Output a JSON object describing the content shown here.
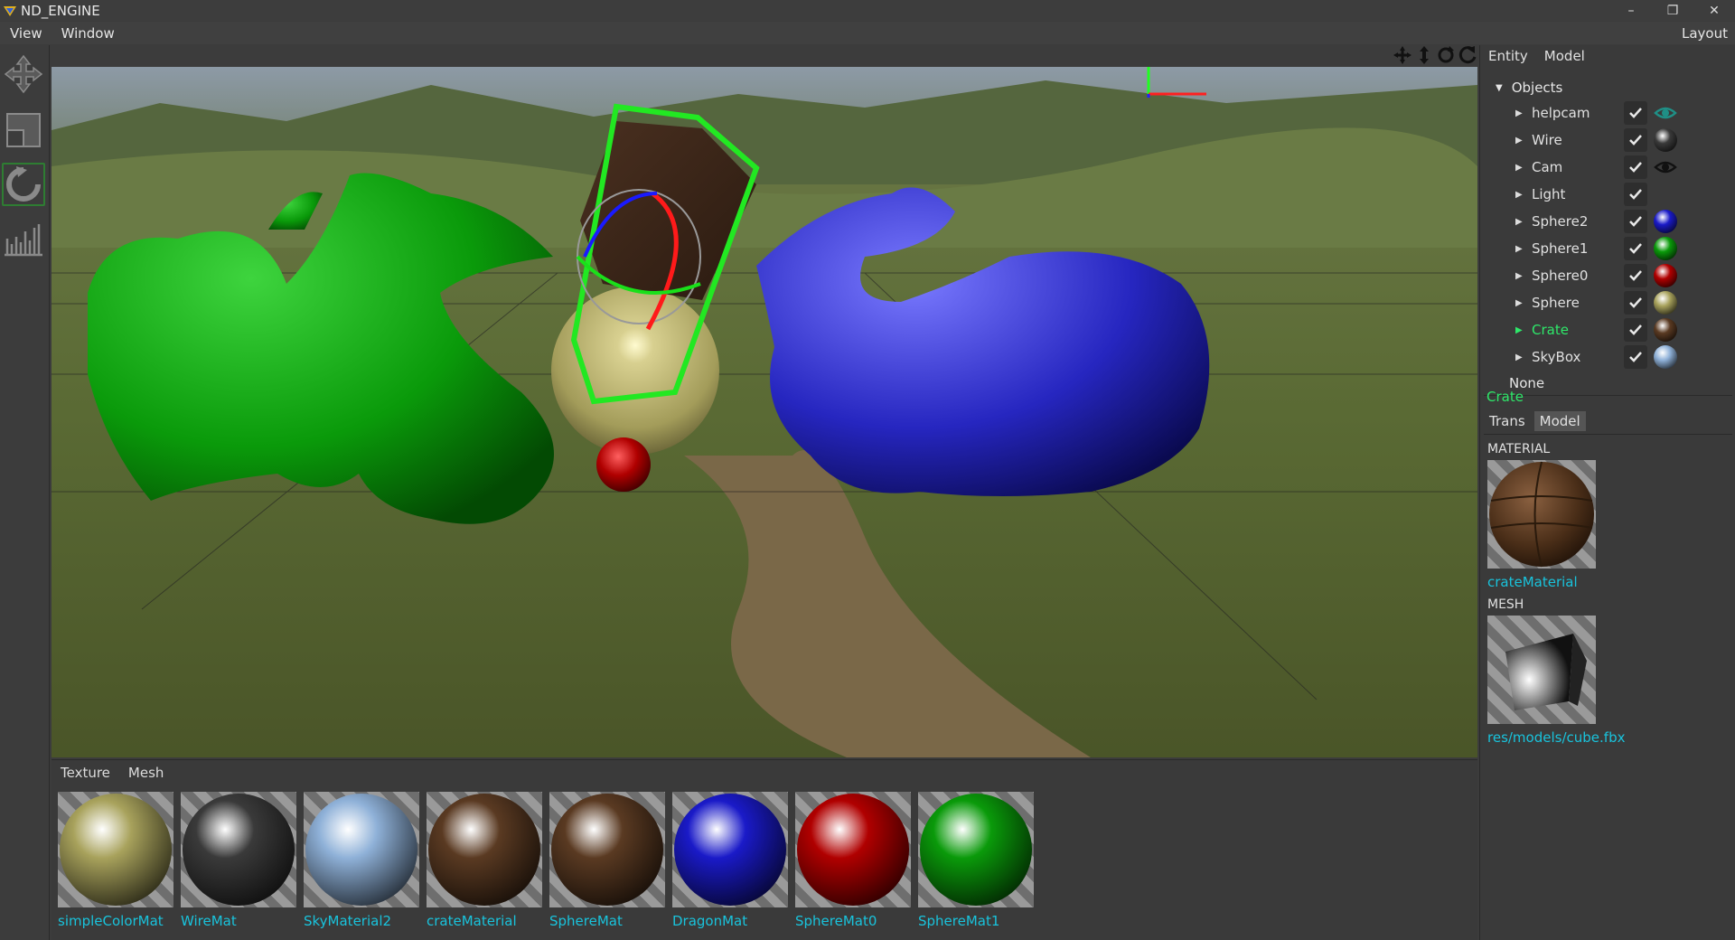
{
  "window": {
    "title": "ND_ENGINE",
    "controls": [
      "–",
      "❐",
      "✕"
    ]
  },
  "menubar": {
    "items": [
      "View",
      "Window"
    ],
    "right": "Layout"
  },
  "toolbar": {
    "tools": [
      "move-tool",
      "scale-tool",
      "rotate-tool",
      "stats-tool"
    ],
    "active": "rotate-tool"
  },
  "colors": {
    "accent_green": "#2ee86a",
    "link_cyan": "#19c3dc",
    "panel_bg": "#3a3a3a",
    "gizmo_x": "#ff2020",
    "gizmo_y": "#20ff20",
    "gizmo_z": "#2020ff"
  },
  "viewport": {
    "gizmo_controls": [
      "move-icon",
      "vertical-move-icon",
      "rotate-icon",
      "orbit-icon"
    ]
  },
  "browser": {
    "tabs": [
      "Texture",
      "Mesh"
    ],
    "assets": [
      {
        "label": "simpleColorMat",
        "swatch": "#a8a25c"
      },
      {
        "label": "WireMat",
        "swatch": "#3a3a3a"
      },
      {
        "label": "SkyMaterial2",
        "swatch": "#8fb1d8"
      },
      {
        "label": "crateMaterial",
        "swatch": "#5a3a22"
      },
      {
        "label": "SphereMat",
        "swatch": "#5a3a22"
      },
      {
        "label": "DragonMat",
        "swatch": "#1a1ac8"
      },
      {
        "label": "SphereMat0",
        "swatch": "#b00000"
      },
      {
        "label": "SphereMat1",
        "swatch": "#0a9a0a"
      }
    ]
  },
  "rightpanel": {
    "tabs": [
      "Entity",
      "Model"
    ],
    "objects_label": "Objects",
    "objects": [
      {
        "name": "helpcam",
        "preview": "eye-icon-dim"
      },
      {
        "name": "Wire",
        "preview": "#3a3a3a"
      },
      {
        "name": "Cam",
        "preview": "eye-icon"
      },
      {
        "name": "Light",
        "preview": ""
      },
      {
        "name": "Sphere2",
        "preview": "#1a1ac8"
      },
      {
        "name": "Sphere1",
        "preview": "#0a9a0a"
      },
      {
        "name": "Sphere0",
        "preview": "#b00000"
      },
      {
        "name": "Sphere",
        "preview": "#a8a25c"
      },
      {
        "name": "Crate",
        "preview": "#5a3a22",
        "selected": true
      },
      {
        "name": "SkyBox",
        "preview": "#8fb1d8"
      }
    ],
    "none_label": "None",
    "selected_name": "Crate",
    "prop_tabs": [
      "Trans",
      "Model"
    ],
    "prop_active": "Model",
    "material_header": "MATERIAL",
    "material_name": "crateMaterial",
    "mesh_header": "MESH",
    "mesh_path": "res/models/cube.fbx"
  }
}
